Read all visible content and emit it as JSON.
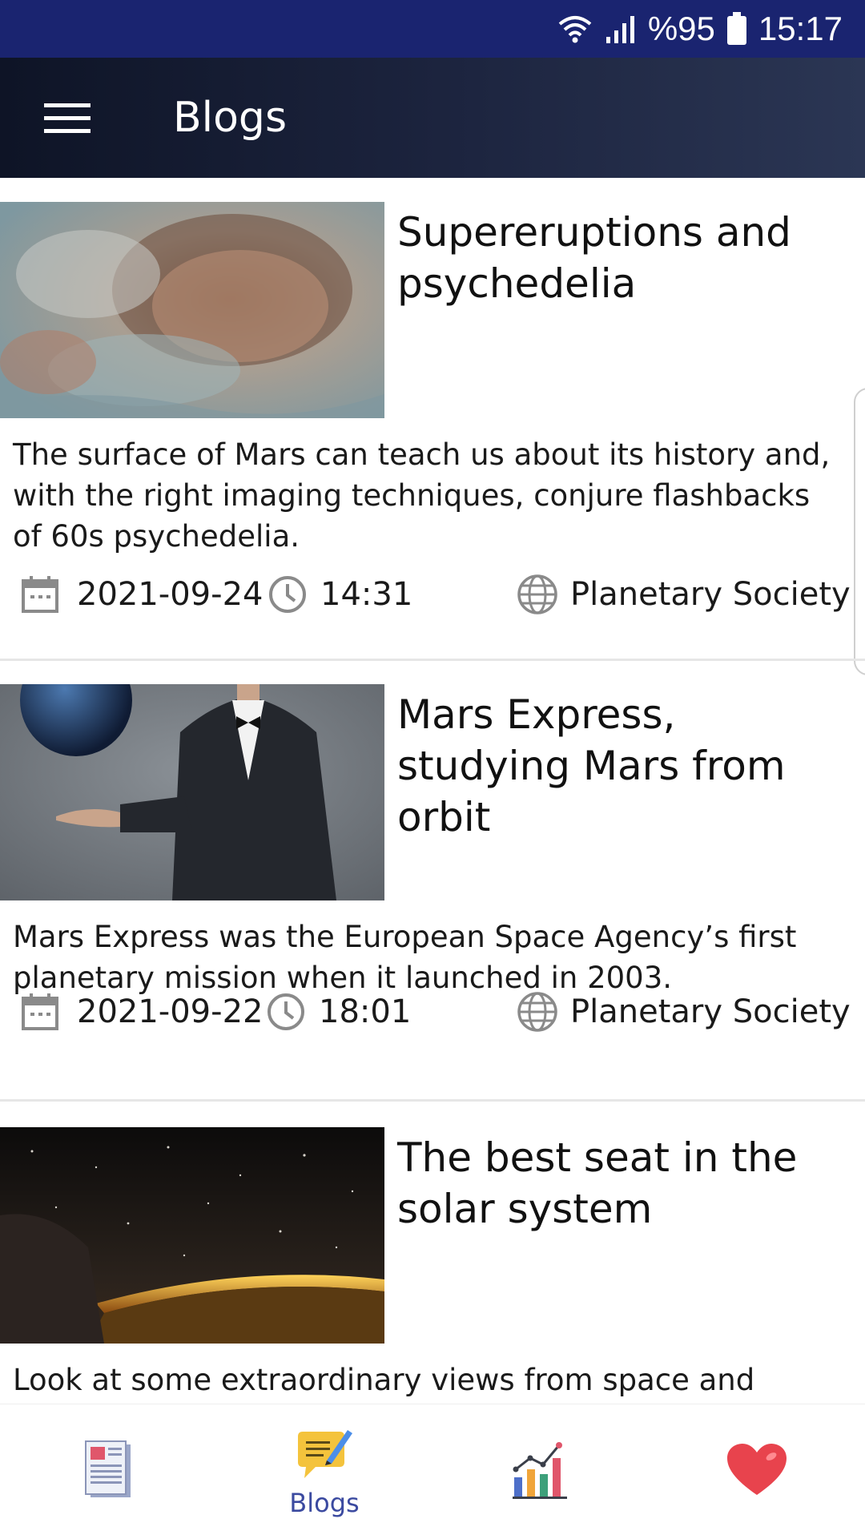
{
  "status_bar": {
    "battery": "%95",
    "time": "15:17",
    "icons": [
      "wifi-icon",
      "signal-icon",
      "battery-icon"
    ]
  },
  "app_bar": {
    "title": "Blogs",
    "menu_icon": "hamburger-menu-icon"
  },
  "posts": [
    {
      "title": "Supereruptions and psychedelia",
      "description": "The surface of Mars can teach us about its history and, with the right imaging techniques, conjure flashbacks of 60s psychedelia.",
      "date": "2021-09-24",
      "time": "14:31",
      "source": "Planetary Society",
      "image": "mars-surface-photo"
    },
    {
      "title": "Mars Express, studying Mars from orbit",
      "description": "Mars Express was the European Space Agency’s first planetary mission when it launched in 2003.",
      "date": "2021-09-22",
      "time": "18:01",
      "source": "Planetary Society",
      "image": "man-in-suit-with-planet-photo"
    },
    {
      "title": "The best seat in the solar system",
      "description": "Look at some extraordinary views from space and",
      "image": "earth-night-from-space-photo"
    }
  ],
  "bottom_nav": {
    "items": [
      {
        "icon": "news-icon",
        "label": ""
      },
      {
        "icon": "blog-pen-icon",
        "label": "Blogs",
        "active": true
      },
      {
        "icon": "chart-icon",
        "label": ""
      },
      {
        "icon": "heart-icon",
        "label": ""
      }
    ],
    "active_color": "#3b4aa0"
  },
  "colors": {
    "status_bar": "#1a2470",
    "app_bar": "#1d2540"
  }
}
